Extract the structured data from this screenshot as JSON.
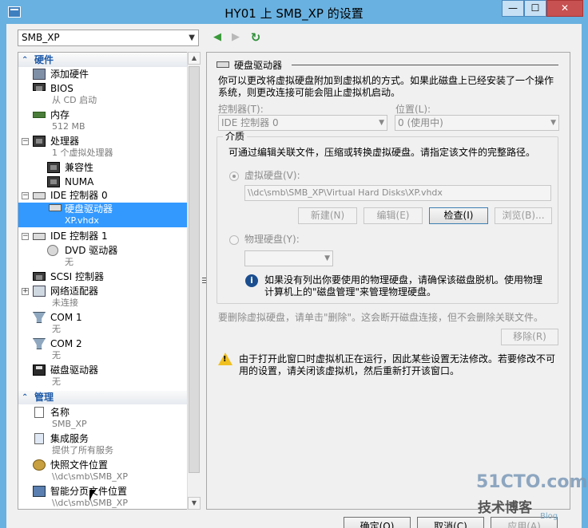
{
  "window": {
    "title": "HY01 上 SMB_XP 的设置",
    "min_glyph": "—",
    "max_glyph": "☐",
    "close_glyph": "✕"
  },
  "toolbar": {
    "vm_select": "SMB_XP",
    "back_glyph": "◀",
    "forward_glyph": "▶",
    "refresh_glyph": "↻"
  },
  "tree": {
    "hardware_section": "硬件",
    "management_section": "管理",
    "items": [
      {
        "label": "添加硬件",
        "sub": ""
      },
      {
        "label": "BIOS",
        "sub": "从 CD 启动"
      },
      {
        "label": "内存",
        "sub": "512 MB"
      },
      {
        "label": "处理器",
        "sub": "1 个虚拟处理器"
      },
      {
        "label": "兼容性",
        "sub": ""
      },
      {
        "label": "NUMA",
        "sub": ""
      },
      {
        "label": "IDE 控制器 0",
        "sub": ""
      },
      {
        "label": "硬盘驱动器",
        "sub": "XP.vhdx"
      },
      {
        "label": "IDE 控制器 1",
        "sub": ""
      },
      {
        "label": "DVD 驱动器",
        "sub": "无"
      },
      {
        "label": "SCSI 控制器",
        "sub": ""
      },
      {
        "label": "网络适配器",
        "sub": "未连接"
      },
      {
        "label": "COM 1",
        "sub": "无"
      },
      {
        "label": "COM 2",
        "sub": "无"
      },
      {
        "label": "磁盘驱动器",
        "sub": "无"
      }
    ],
    "mgmt_items": [
      {
        "label": "名称",
        "sub": "SMB_XP"
      },
      {
        "label": "集成服务",
        "sub": "提供了所有服务"
      },
      {
        "label": "快照文件位置",
        "sub": "\\\\dc\\smb\\SMB_XP"
      },
      {
        "label": "智能分页文件位置",
        "sub": "\\\\dc\\smb\\SMB_XP"
      }
    ]
  },
  "panel": {
    "header": "硬盘驱动器",
    "intro_line1": "你可以更改将虚拟硬盘附加到虚拟机的方式。如果此磁盘上已经安装了一个操作",
    "intro_line2": "系统，则更改连接可能会阻止虚拟机启动。",
    "controller_label": "控制器(T):",
    "controller_value": "IDE 控制器 0",
    "location_label": "位置(L):",
    "location_value": "0 (使用中)",
    "media_label": "介质",
    "media_desc": "可通过编辑关联文件，压缩或转换虚拟硬盘。请指定该文件的完整路径。",
    "vhd_radio": "虚拟硬盘(V):",
    "vhd_path": "\\\\dc\\smb\\SMB_XP\\Virtual Hard Disks\\XP.vhdx",
    "new_btn": "新建(N)",
    "edit_btn": "编辑(E)",
    "inspect_btn": "检查(I)",
    "browse_btn": "浏览(B)...",
    "phys_radio": "物理硬盘(Y):",
    "phys_info_line1": "如果没有列出你要使用的物理硬盘，请确保该磁盘脱机。使用物理",
    "phys_info_line2": "计算机上的\"磁盘管理\"来管理物理硬盘。",
    "remove_desc": "要删除虚拟硬盘，请单击\"删除\"。这会断开磁盘连接，但不会删除关联文件。",
    "remove_btn": "移除(R)",
    "warn_line1": "由于打开此窗口时虚拟机正在运行，因此某些设置无法修改。若要修改不可",
    "warn_line2": "用的设置，请关闭该虚拟机，然后重新打开该窗口。"
  },
  "footer": {
    "ok_btn": "确定(O)",
    "cancel_btn": "取消(C)",
    "apply_btn": "应用(A)"
  },
  "watermark": {
    "line1": "51CTO.com",
    "line2": "技术博客",
    "line3": "Blog"
  }
}
